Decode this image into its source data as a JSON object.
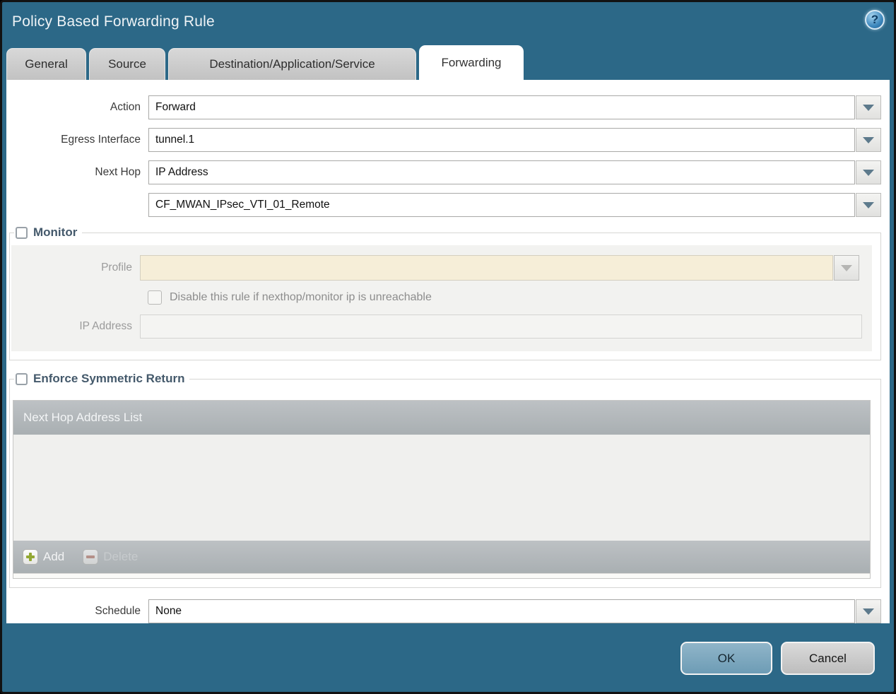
{
  "window": {
    "title": "Policy Based Forwarding Rule"
  },
  "help": {
    "glyph": "?"
  },
  "tabs": [
    {
      "label": "General",
      "active": false
    },
    {
      "label": "Source",
      "active": false
    },
    {
      "label": "Destination/Application/Service",
      "active": false
    },
    {
      "label": "Forwarding",
      "active": true
    }
  ],
  "form": {
    "action_label": "Action",
    "action_value": "Forward",
    "egress_label": "Egress Interface",
    "egress_value": "tunnel.1",
    "nexthop_label": "Next Hop",
    "nexthop_value": "IP Address",
    "nexthop_address_value": "CF_MWAN_IPsec_VTI_01_Remote",
    "schedule_label": "Schedule",
    "schedule_value": "None"
  },
  "monitor": {
    "legend": "Monitor",
    "checked": false,
    "profile_label": "Profile",
    "profile_value": "",
    "disable_label": "Disable this rule if nexthop/monitor ip is unreachable",
    "disable_checked": false,
    "ip_label": "IP Address",
    "ip_value": ""
  },
  "enforce": {
    "legend": "Enforce Symmetric Return",
    "checked": false,
    "list_header": "Next Hop Address List",
    "add_label": "Add",
    "delete_label": "Delete"
  },
  "footer": {
    "ok_label": "OK",
    "cancel_label": "Cancel"
  },
  "colors": {
    "titlebar": "#2c6887",
    "active_tab_bg": "#ffffff",
    "inactive_tab_bg": "#c9c9c9",
    "table_header": "#b2b6b9",
    "disabled_profile_field": "#f6eed8",
    "ok_button": "#7fa9bf",
    "cancel_button": "#c9c9c9",
    "add_icon_green": "#93a833",
    "delete_icon_red": "#b5786b"
  }
}
